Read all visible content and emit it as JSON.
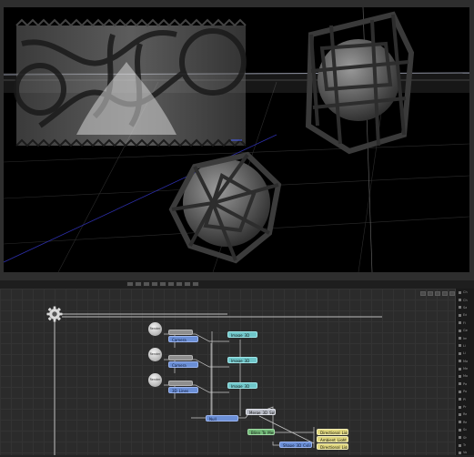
{
  "flow": {
    "nodes": {
      "image1": "Image_3D",
      "image2": "Image_3D",
      "image3": "Image_3D",
      "camera1": "Camera",
      "camera2": "Camera",
      "lines": "3D_Lines",
      "merge": "Merge_3D_Sphere",
      "material": "Blinn_To_Mesh",
      "cylinder": "Shape_3D_Cylinder",
      "light1": "Directional_Light",
      "light2": "Ambient_Light",
      "light3": "Directional_Light",
      "null": "Null"
    },
    "bubbles": [
      "Render",
      "Render",
      "Render"
    ]
  },
  "panel": {
    "items": [
      "Ch",
      "Ch",
      "Sa",
      "Ed",
      "Fi",
      "Ge",
      "Im",
      "Li",
      "Li",
      "Ma",
      "Me",
      "Mo",
      "Pa",
      "Po",
      "Pl",
      "Pr",
      "Re",
      "Re",
      "Sc",
      "Sh",
      "Tr",
      "Vo"
    ]
  },
  "colors": {
    "teal_node": "#6fc6c9",
    "blue_node": "#6b8fd6",
    "green_node": "#72b878",
    "yellow_node": "#e0d77e",
    "gray_node": "#8e8e8e"
  },
  "icons": {
    "gear": "gear-icon",
    "toolbar": "toolbar-button-icon"
  }
}
